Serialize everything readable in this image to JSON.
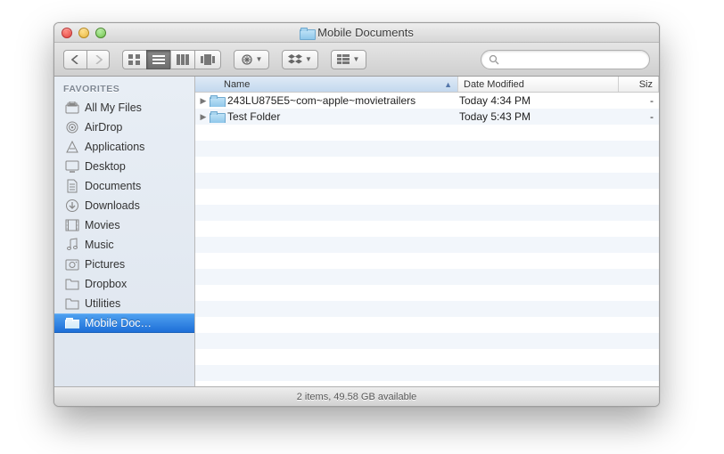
{
  "window": {
    "title": "Mobile Documents"
  },
  "sidebar": {
    "header": "FAVORITES",
    "items": [
      {
        "label": "All My Files",
        "icon": "all-my-files-icon"
      },
      {
        "label": "AirDrop",
        "icon": "airdrop-icon"
      },
      {
        "label": "Applications",
        "icon": "applications-icon"
      },
      {
        "label": "Desktop",
        "icon": "desktop-icon"
      },
      {
        "label": "Documents",
        "icon": "documents-icon"
      },
      {
        "label": "Downloads",
        "icon": "downloads-icon"
      },
      {
        "label": "Movies",
        "icon": "movies-icon"
      },
      {
        "label": "Music",
        "icon": "music-icon"
      },
      {
        "label": "Pictures",
        "icon": "pictures-icon"
      },
      {
        "label": "Dropbox",
        "icon": "folder-icon"
      },
      {
        "label": "Utilities",
        "icon": "folder-icon"
      },
      {
        "label": "Mobile Doc…",
        "icon": "folder-icon",
        "selected": true
      }
    ]
  },
  "columns": {
    "name": "Name",
    "modified": "Date Modified",
    "size": "Siz"
  },
  "files": [
    {
      "name": "243LU875E5~com~apple~movietrailers",
      "modified": "Today 4:34 PM",
      "size": "-"
    },
    {
      "name": "Test Folder",
      "modified": "Today 5:43 PM",
      "size": "-"
    }
  ],
  "status": "2 items, 49.58 GB available",
  "search": {
    "placeholder": ""
  }
}
